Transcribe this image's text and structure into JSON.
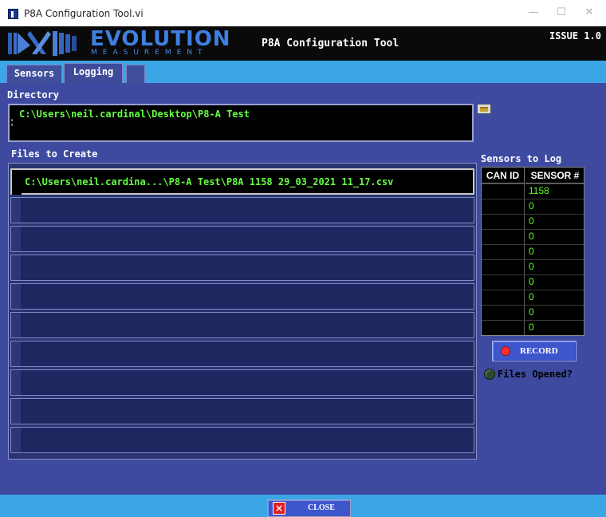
{
  "window": {
    "title": "P8A Configuration Tool.vi",
    "minimize_glyph": "—",
    "maximize_glyph": "☐",
    "close_glyph": "✕"
  },
  "header": {
    "logo_main": "EVOLUTION",
    "logo_sub": "MEASUREMENT",
    "app_title": "P8A Configuration Tool",
    "issue": "ISSUE 1.0"
  },
  "tabs": [
    {
      "label": "Sensors",
      "active": false
    },
    {
      "label": "Logging",
      "active": true
    }
  ],
  "directory": {
    "label": "Directory",
    "value": "C:\\Users\\neil.cardinal\\Desktop\\P8-A Test"
  },
  "files": {
    "label": "Files to Create",
    "items": [
      "C:\\Users\\neil.cardina...\\P8-A Test\\P8A 1158 29_03_2021 11_17.csv",
      "",
      "",
      "",
      "",
      "",
      "",
      "",
      "",
      ""
    ]
  },
  "sensors": {
    "label": "Sensors to Log",
    "col_can_id": "CAN ID",
    "col_sensor": "SENSOR #",
    "values": [
      "1158",
      "0",
      "0",
      "0",
      "0",
      "0",
      "0",
      "0",
      "0",
      "0"
    ]
  },
  "record_button": "RECORD",
  "files_opened": "Files Opened?",
  "close_button": "CLOSE",
  "colors": {
    "accent_blue": "#3aa6e6",
    "panel": "#3d4aa0",
    "path_green": "#66ff44",
    "record_led": "#ff3030"
  },
  "icons": [
    "app-icon",
    "logo-mark",
    "folder-icon",
    "record-led-icon",
    "status-led-icon",
    "close-x-icon"
  ]
}
